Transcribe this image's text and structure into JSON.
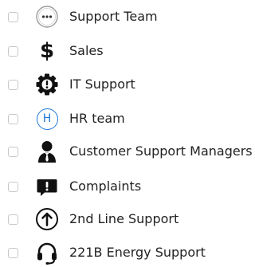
{
  "teams": [
    {
      "label": "Support Team",
      "icon": "ellipsis-circle-icon",
      "checked": false
    },
    {
      "label": "Sales",
      "icon": "dollar-icon",
      "glyph": "$",
      "checked": false
    },
    {
      "label": "IT Support",
      "icon": "gear-exclamation-icon",
      "checked": false
    },
    {
      "label": "HR team",
      "icon": "letter-h-circle-icon",
      "glyph": "H",
      "checked": false
    },
    {
      "label": "Customer Support Managers",
      "icon": "manager-person-icon",
      "checked": false
    },
    {
      "label": "Complaints",
      "icon": "speech-bubble-exclamation-icon",
      "checked": false
    },
    {
      "label": "2nd Line Support",
      "icon": "arrow-up-circle-icon",
      "checked": false
    },
    {
      "label": "221B Energy Support",
      "icon": "headset-icon",
      "checked": false
    }
  ],
  "colors": {
    "hr_accent": "#1e78d7",
    "icon_dark": "#111111",
    "checkbox_border": "#c8c8c8"
  }
}
